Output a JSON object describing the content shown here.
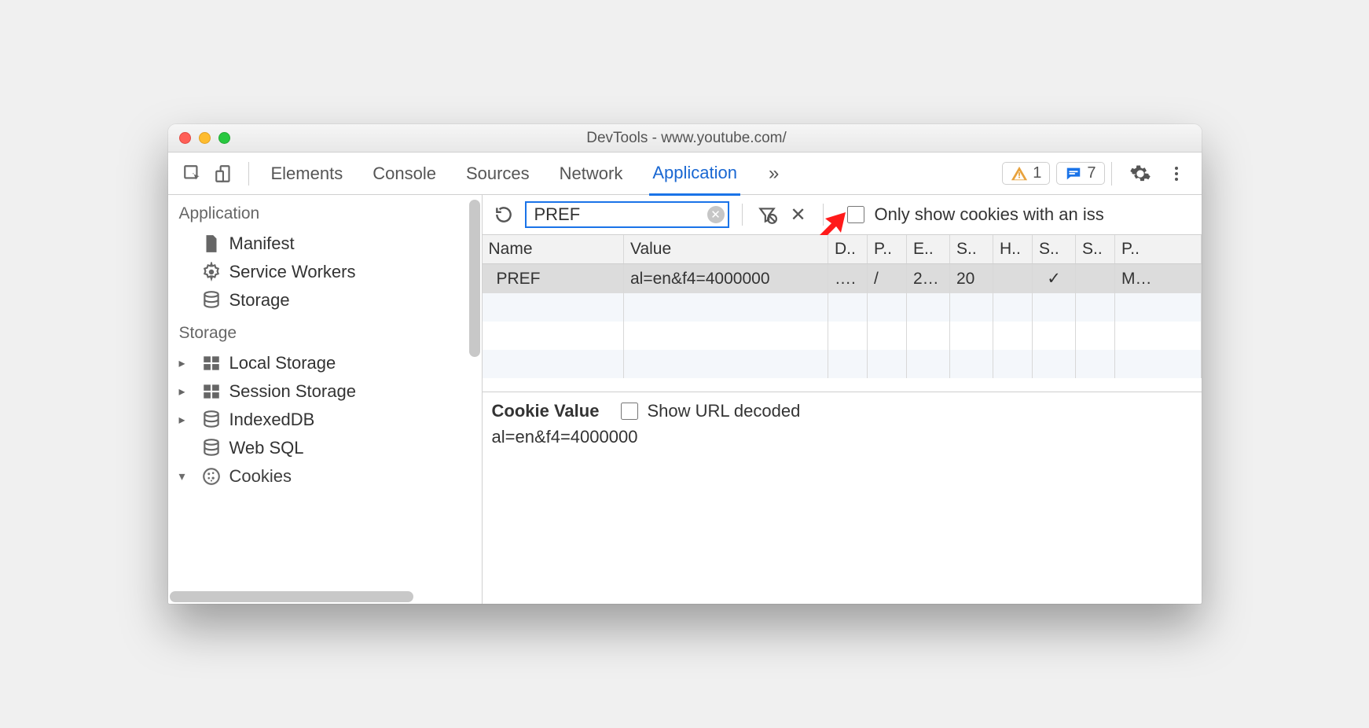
{
  "window": {
    "title": "DevTools - www.youtube.com/"
  },
  "tabs": {
    "items": [
      "Elements",
      "Console",
      "Sources",
      "Network",
      "Application"
    ],
    "active_index": 4,
    "overflow_glyph": "»",
    "warn_count": "1",
    "msg_count": "7"
  },
  "sidebar": {
    "sections": [
      {
        "title": "Application",
        "items": [
          {
            "label": "Manifest",
            "icon": "file-icon"
          },
          {
            "label": "Service Workers",
            "icon": "gear-icon"
          },
          {
            "label": "Storage",
            "icon": "db-icon"
          }
        ]
      },
      {
        "title": "Storage",
        "items": [
          {
            "label": "Local Storage",
            "icon": "grid-icon",
            "branch": true
          },
          {
            "label": "Session Storage",
            "icon": "grid-icon",
            "branch": true
          },
          {
            "label": "IndexedDB",
            "icon": "db-icon",
            "branch": true
          },
          {
            "label": "Web SQL",
            "icon": "db-icon"
          },
          {
            "label": "Cookies",
            "icon": "cookie-icon",
            "branch": true,
            "open": true
          }
        ]
      }
    ]
  },
  "toolbar": {
    "filter_value": "PREF",
    "only_issue_label": "Only show cookies with an iss"
  },
  "table": {
    "columns": [
      "Name",
      "Value",
      "D..",
      "P..",
      "E..",
      "S..",
      "H..",
      "S..",
      "S..",
      "P.."
    ],
    "rows": [
      {
        "cells": [
          "PREF",
          "al=en&f4=4000000",
          "….",
          "/",
          "2…",
          "20",
          "",
          "✓",
          "",
          "M…"
        ],
        "selected": true
      }
    ]
  },
  "detail": {
    "heading": "Cookie Value",
    "show_decoded_label": "Show URL decoded",
    "value": "al=en&f4=4000000"
  }
}
